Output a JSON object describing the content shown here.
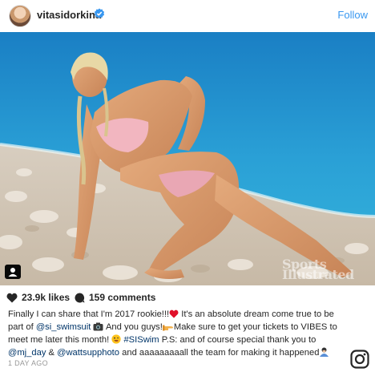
{
  "post": {
    "username": "vitasidorkina",
    "verified_icon": "verified-badge-icon",
    "follow_label": "Follow",
    "likes": "23.9k likes",
    "comments": "159 comments",
    "time": "1 DAY AGO",
    "watermark_line1": "Sports",
    "watermark_line2": "Illustrated"
  },
  "caption": {
    "t1": "Finally I can share that I'm 2017 rookie!!!",
    "t2": " It's an absolute dream come true to be part of ",
    "m1": "@si_swimsuit",
    "t3": " And you guys!",
    "t4": "Make sure to get your tickets to VIBES to meet me later this month! ",
    "h1": "#SISwim",
    "t5": " P.S: and of course special thank you to ",
    "m2": "@mj_day",
    "t6": " & ",
    "m3": "@wattsupphoto",
    "t7": " and aaaaaaaaall the team for making it happened"
  },
  "colors": {
    "link": "#003569",
    "follow": "#3897f0",
    "meta": "#999999"
  }
}
